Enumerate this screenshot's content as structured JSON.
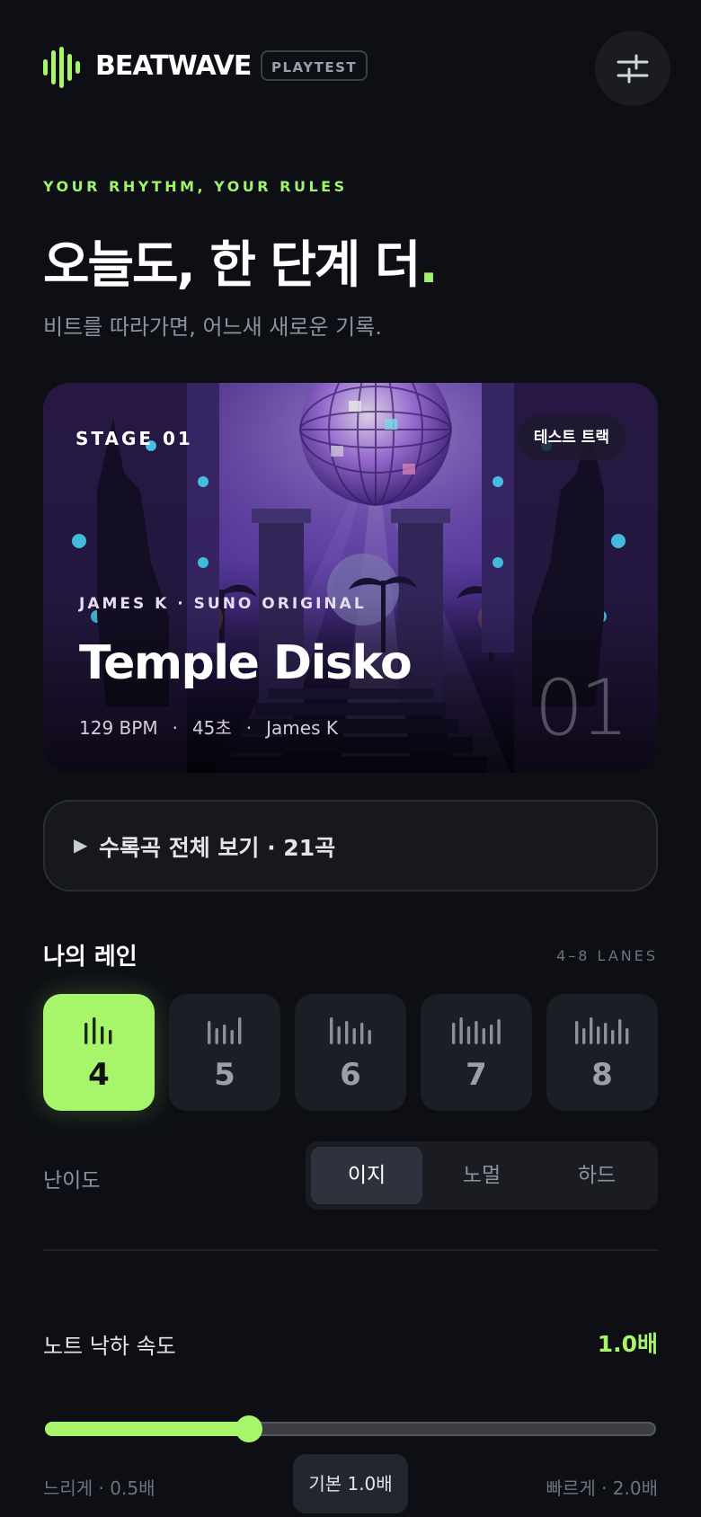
{
  "app": {
    "brand": "BEATWAVE",
    "badge": "PLAYTEST",
    "settings_icon": "sliders-icon",
    "accent": "#a6f56b"
  },
  "hero": {
    "tagline": "YOUR RHYTHM, YOUR RULES",
    "headline": "오늘도, 한 단계 더",
    "headline_dot": ".",
    "subtitle": "비트를 따라가면, 어느새 새로운 기록."
  },
  "track_card": {
    "stage": "STAGE 01",
    "badge": "테스트 트랙",
    "artist_line": "JAMES K · SUNO ORIGINAL",
    "title": "Temple Disko",
    "bpm": "129 BPM",
    "duration": "45초",
    "artist": "James K",
    "separator": "·",
    "number": "01"
  },
  "tracklist": {
    "icon": "play-triangle-icon",
    "label": "수록곡 전체 보기 · 21곡"
  },
  "lanes": {
    "title": "나의 레인",
    "range": "4–8 LANES",
    "options": [
      "4",
      "5",
      "6",
      "7",
      "8"
    ],
    "selected": "4"
  },
  "difficulty": {
    "label": "난이도",
    "options": [
      "이지",
      "노멀",
      "하드"
    ],
    "selected": "이지"
  },
  "speed": {
    "label": "노트 낙하 속도",
    "value": "1.0배",
    "level": 1.0,
    "min": 0.5,
    "max": 2.0,
    "slow_label": "느리게 · 0.5배",
    "default_label": "기본 1.0배",
    "fast_label": "빠르게 · 2.0배"
  }
}
